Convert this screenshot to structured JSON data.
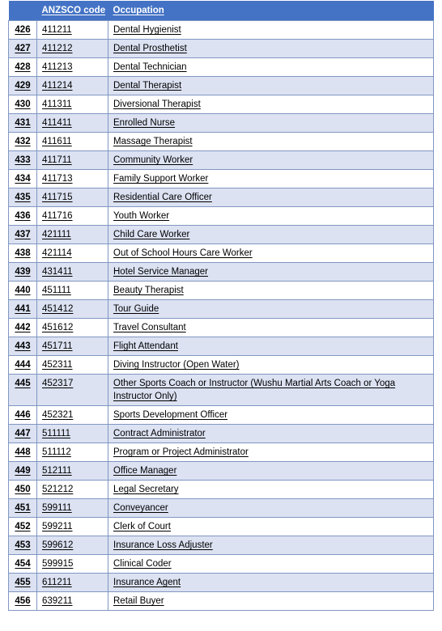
{
  "table": {
    "columns": [
      {
        "key": "index",
        "label": ""
      },
      {
        "key": "anzsco_code",
        "label": "ANZSCO code"
      },
      {
        "key": "occupation",
        "label": "Occupation"
      }
    ],
    "colors": {
      "header_background": "#4473C5",
      "header_text": "#FFFFFF",
      "row_alt_background": "#DCE2F2",
      "row_background": "#FFFFFF",
      "border": "#8096C2",
      "text": "#000000"
    },
    "rows": [
      {
        "index": "426",
        "anzsco_code": "411211",
        "occupation": "Dental Hygienist"
      },
      {
        "index": "427",
        "anzsco_code": "411212",
        "occupation": "Dental Prosthetist"
      },
      {
        "index": "428",
        "anzsco_code": "411213",
        "occupation": "Dental Technician"
      },
      {
        "index": "429",
        "anzsco_code": "411214",
        "occupation": "Dental Therapist"
      },
      {
        "index": "430",
        "anzsco_code": "411311",
        "occupation": "Diversional Therapist"
      },
      {
        "index": "431",
        "anzsco_code": "411411",
        "occupation": "Enrolled Nurse"
      },
      {
        "index": "432",
        "anzsco_code": "411611",
        "occupation": "Massage Therapist"
      },
      {
        "index": "433",
        "anzsco_code": "411711",
        "occupation": "Community Worker"
      },
      {
        "index": "434",
        "anzsco_code": "411713",
        "occupation": "Family Support Worker"
      },
      {
        "index": "435",
        "anzsco_code": "411715",
        "occupation": "Residential Care Officer"
      },
      {
        "index": "436",
        "anzsco_code": "411716",
        "occupation": "Youth Worker"
      },
      {
        "index": "437",
        "anzsco_code": "421111",
        "occupation": "Child Care Worker"
      },
      {
        "index": "438",
        "anzsco_code": "421114",
        "occupation": "Out of School Hours Care Worker"
      },
      {
        "index": "439",
        "anzsco_code": "431411",
        "occupation": "Hotel Service Manager"
      },
      {
        "index": "440",
        "anzsco_code": "451111",
        "occupation": "Beauty Therapist"
      },
      {
        "index": "441",
        "anzsco_code": "451412",
        "occupation": "Tour Guide"
      },
      {
        "index": "442",
        "anzsco_code": "451612",
        "occupation": "Travel Consultant"
      },
      {
        "index": "443",
        "anzsco_code": "451711",
        "occupation": "Flight Attendant"
      },
      {
        "index": "444",
        "anzsco_code": "452311",
        "occupation": "Diving Instructor (Open Water)"
      },
      {
        "index": "445",
        "anzsco_code": "452317",
        "occupation": "Other Sports Coach or Instructor (Wushu Martial Arts Coach or Yoga Instructor Only)"
      },
      {
        "index": "446",
        "anzsco_code": "452321",
        "occupation": "Sports Development Officer"
      },
      {
        "index": "447",
        "anzsco_code": "511111",
        "occupation": "Contract Administrator"
      },
      {
        "index": "448",
        "anzsco_code": "511112",
        "occupation": "Program or Project Administrator"
      },
      {
        "index": "449",
        "anzsco_code": "512111",
        "occupation": "Office Manager"
      },
      {
        "index": "450",
        "anzsco_code": "521212",
        "occupation": "Legal Secretary"
      },
      {
        "index": "451",
        "anzsco_code": "599111",
        "occupation": "Conveyancer"
      },
      {
        "index": "452",
        "anzsco_code": "599211",
        "occupation": "Clerk of Court"
      },
      {
        "index": "453",
        "anzsco_code": "599612",
        "occupation": "Insurance Loss Adjuster"
      },
      {
        "index": "454",
        "anzsco_code": "599915",
        "occupation": "Clinical Coder"
      },
      {
        "index": "455",
        "anzsco_code": "611211",
        "occupation": "Insurance Agent"
      },
      {
        "index": "456",
        "anzsco_code": "639211",
        "occupation": "Retail Buyer"
      }
    ]
  }
}
